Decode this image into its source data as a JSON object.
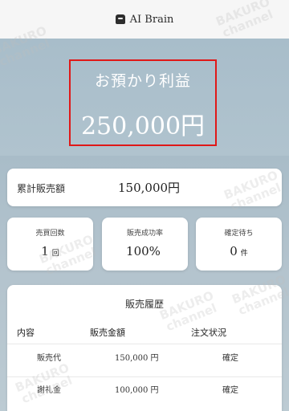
{
  "header": {
    "title": "AI Brain",
    "icon": "robot-icon"
  },
  "hero": {
    "label": "お預かり利益",
    "value": "250,000円"
  },
  "summary": {
    "label": "累計販売額",
    "value": "150,000円"
  },
  "stats": [
    {
      "label": "売買回数",
      "value": "1",
      "unit": "回"
    },
    {
      "label": "販売成功率",
      "value": "100%",
      "unit": ""
    },
    {
      "label": "確定待ち",
      "value": "0",
      "unit": "件"
    }
  ],
  "history": {
    "title": "販売履歴",
    "columns": [
      "内容",
      "販売金額",
      "注文状況"
    ],
    "rows": [
      {
        "type": "販売代",
        "amount": "150,000 円",
        "status": "確定"
      },
      {
        "type": "謝礼金",
        "amount": "100,000 円",
        "status": "確定"
      }
    ]
  },
  "watermark": {
    "line1": "BAKURO",
    "line2": "channel"
  },
  "colors": {
    "accent_red": "#e01818",
    "background": "#a8bcc8"
  }
}
